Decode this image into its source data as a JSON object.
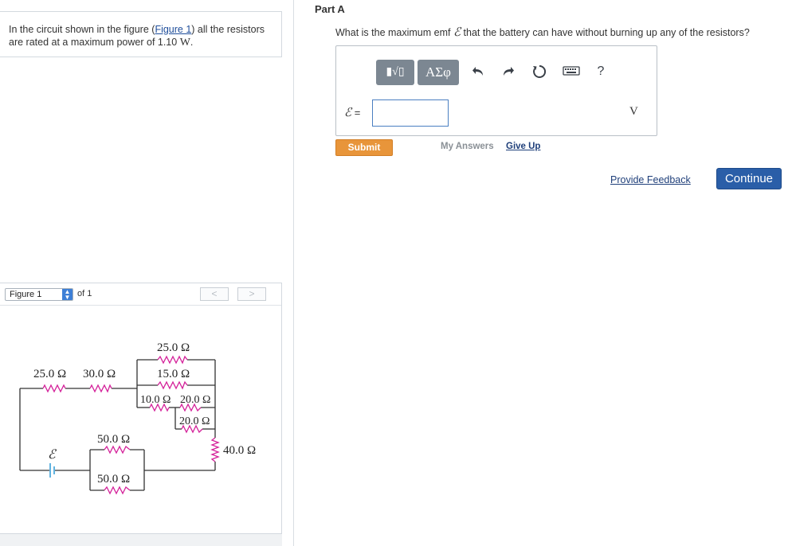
{
  "problem": {
    "text_before": "In the circuit shown in the figure (",
    "figure_link": "Figure 1",
    "text_after": ") all the resistors are rated at a maximum power of 1.10",
    "unit": "W",
    "period": "."
  },
  "figure_nav": {
    "selected": "Figure 1",
    "of_text": "of 1",
    "prev_label": "<",
    "next_label": ">"
  },
  "circuit": {
    "resistor_labels": {
      "r1": "25.0 Ω",
      "r2": "30.0 Ω",
      "r3": "25.0 Ω",
      "r4": "15.0 Ω",
      "r5": "10.0 Ω",
      "r6": "20.0 Ω",
      "r7": "20.0 Ω",
      "r8": "50.0 Ω",
      "r9": "50.0 Ω",
      "r10": "40.0 Ω"
    },
    "battery_label": "ℰ",
    "wire_color": "#333333",
    "resistor_color": "#d4219a",
    "battery_color": "#3aa0d8"
  },
  "part": {
    "title": "Part A",
    "question_before": "What is the maximum emf",
    "emf_symbol": "ℰ",
    "question_after": "that the battery can have without burning up any of the resistors?"
  },
  "answer": {
    "label_symbol": "ℰ",
    "label_eq": "=",
    "value": "",
    "unit": "V"
  },
  "toolbar": {
    "templates_label": "▮√▯",
    "symbols_label": "ΑΣφ",
    "undo_icon": "undo-icon",
    "redo_icon": "redo-icon",
    "reset_icon": "reset-icon",
    "keyboard_icon": "keyboard-icon",
    "help_label": "?"
  },
  "actions": {
    "submit": "Submit",
    "my_answers": "My Answers",
    "give_up": "Give Up",
    "feedback": "Provide Feedback",
    "continue": "Continue"
  },
  "colors": {
    "submit": "#e8953a",
    "continue": "#2a5ea8",
    "link": "#1f3f7a",
    "toolbar": "#7c8792"
  }
}
